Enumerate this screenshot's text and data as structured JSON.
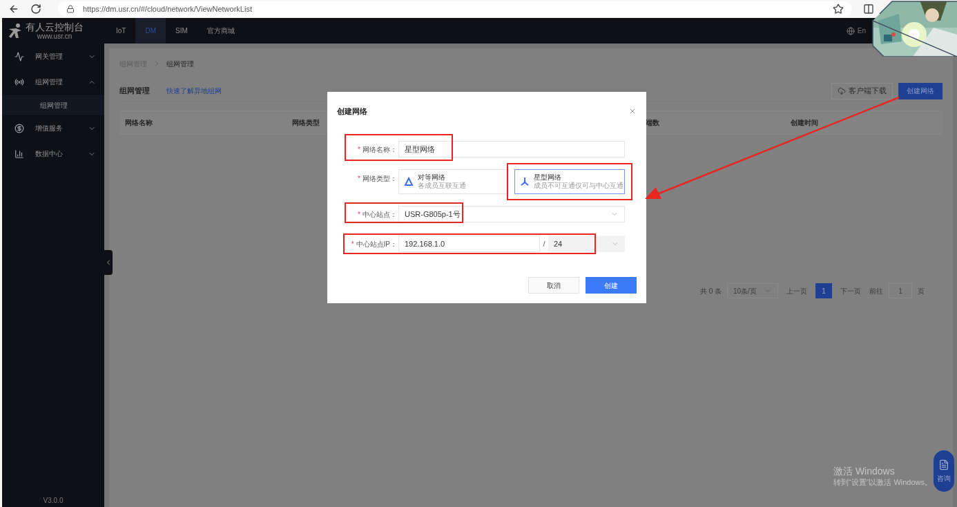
{
  "browser": {
    "url": "https://dm.usr.cn/#/cloud/network/ViewNetworkList"
  },
  "logo": {
    "title": "有人云控制台",
    "subtitle": "www.usr.cn"
  },
  "top_nav": [
    {
      "label": "IoT",
      "selected": false
    },
    {
      "label": "DM",
      "selected": true
    },
    {
      "label": "SIM",
      "selected": false
    },
    {
      "label": "官方商城",
      "selected": false
    }
  ],
  "language": "En",
  "sidebar": {
    "items": [
      {
        "label": "网关管理",
        "kind": "gateway",
        "expanded": false
      },
      {
        "label": "组网管理",
        "kind": "network",
        "expanded": true,
        "children": [
          {
            "label": "组网管理",
            "selected": true
          }
        ]
      },
      {
        "label": "增值服务",
        "kind": "coin",
        "expanded": false
      },
      {
        "label": "数据中心",
        "kind": "chart",
        "expanded": false
      }
    ],
    "version": "V3.0.0"
  },
  "breadcrumb": [
    "组网管理",
    "组网管理"
  ],
  "page": {
    "title": "组网管理",
    "help_link": "快速了解异地组网",
    "download_button": "客户端下载",
    "create_button": "创建网络"
  },
  "table": {
    "columns": [
      "网络名称",
      "网络类型",
      "端数",
      "创建时间"
    ]
  },
  "pagination": {
    "total": "共 0 条",
    "page_size": "10条/页",
    "prev": "上一页",
    "pages": [
      {
        "label": "1",
        "selected": true
      }
    ],
    "next": "下一页",
    "goto_label": "前往",
    "goto_value": "1",
    "page_unit": "页"
  },
  "modal": {
    "title": "创建网络",
    "name_field": {
      "required_mark": "*",
      "label": "网络名称：",
      "value": "星型网络"
    },
    "type_field": {
      "required_mark": "*",
      "label": "网络类型：",
      "options": [
        {
          "kind": "peer",
          "title": "对等网络",
          "description": "各成员互联互通",
          "selected": false
        },
        {
          "kind": "star",
          "title": "星型网络",
          "description": "成员不可互通仅可与中心互通",
          "selected": true
        }
      ]
    },
    "center_field": {
      "required_mark": "*",
      "label": "中心站点：",
      "value": "USR-G805p-1号"
    },
    "ip_field": {
      "required_mark": "*",
      "label": "中心站点IP：",
      "value": "192.168.1.0",
      "separator": "/",
      "mask": "24"
    },
    "cancel_button": "取消",
    "submit_button": "创建"
  },
  "consult_button": "咨询",
  "windows_notice": {
    "title": "激活 Windows",
    "text": "转到“设置”以激活 Windows。"
  }
}
